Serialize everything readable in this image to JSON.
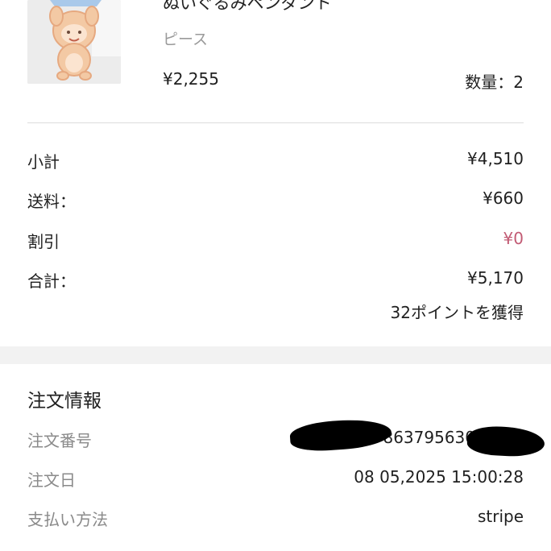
{
  "product": {
    "title": "ぬいぐるみペンダント",
    "variant": "ピース",
    "price": "¥2,255",
    "quantity": "数量：2"
  },
  "summary": [
    {
      "label": "小計",
      "value": "¥4,510"
    },
    {
      "label": "送料：",
      "value": "¥660"
    },
    {
      "label": "割引",
      "value": "¥0"
    },
    {
      "label": "合計：",
      "value": "¥5,170"
    }
  ],
  "points": "32ポイントを獲得",
  "order_info": {
    "title": "注文情報",
    "rows": [
      {
        "label": "注文番号",
        "value": "863795630"
      },
      {
        "label": "注文日",
        "value": "08 05,2025 15:00:28"
      },
      {
        "label": "支払い方法",
        "value": "stripe"
      }
    ]
  },
  "colors": {
    "discount": "#c25b74",
    "muted_label": "#8a8a8a",
    "section_gap": "#f2f2f2"
  }
}
